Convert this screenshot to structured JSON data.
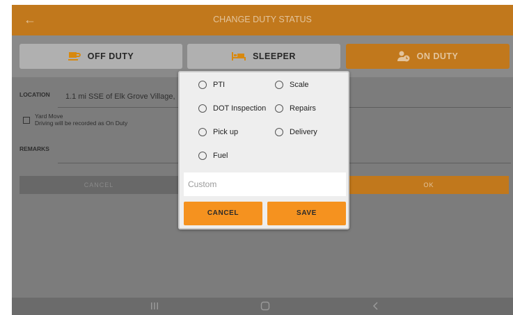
{
  "appbar": {
    "title": "CHANGE DUTY STATUS",
    "back_icon": "arrow-left-icon"
  },
  "duty_buttons": {
    "off_duty": {
      "label": "OFF DUTY",
      "icon": "coffee-cup-icon"
    },
    "sleeper": {
      "label": "SLEEPER",
      "icon": "bed-icon"
    },
    "on_duty": {
      "label": "ON DUTY",
      "icon": "person-clock-icon"
    }
  },
  "form": {
    "location_label": "LOCATION",
    "location_value": "1.1 mi SSE of Elk Grove Village,",
    "yard_move_label": "Yard Move",
    "yard_move_note": "Driving will be recorded as On Duty",
    "remarks_label": "REMARKS",
    "cancel_label": "CANCEL",
    "ok_label": "OK"
  },
  "dialog": {
    "options": [
      {
        "label": "PTI"
      },
      {
        "label": "Scale"
      },
      {
        "label": "DOT Inspection"
      },
      {
        "label": "Repairs"
      },
      {
        "label": "Pick up"
      },
      {
        "label": "Delivery"
      },
      {
        "label": "Fuel"
      }
    ],
    "custom_placeholder": "Custom",
    "cancel_label": "CANCEL",
    "save_label": "SAVE"
  },
  "colors": {
    "accent": "#c1781c",
    "dialog_button": "#f5921f"
  }
}
